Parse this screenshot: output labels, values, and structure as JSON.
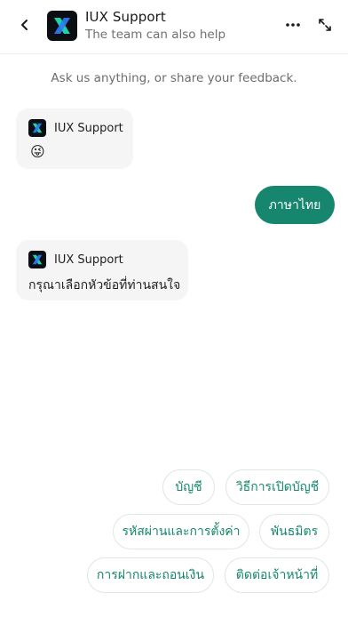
{
  "header": {
    "title": "IUX Support",
    "subtitle": "The team can also help",
    "back_icon": "chevron-left-icon",
    "more_icon": "more-horizontal-icon",
    "expand_icon": "expand-icon",
    "brand_color": "#0b0f14",
    "logo_accent_colors": [
      "#1fd3a8",
      "#2f7cf6"
    ]
  },
  "intro_text": "Ask us anything, or share your feedback.",
  "messages": [
    {
      "sender": "IUX Support",
      "text": "😜",
      "role": "bot"
    },
    {
      "text": "ภาษาไทย",
      "role": "user"
    },
    {
      "sender": "IUX Support",
      "text": "กรุณาเลือกหัวข้อที่ท่านสนใจ",
      "role": "bot"
    }
  ],
  "quick_replies": [
    "บัญชี",
    "วิธีการเปิดบัญชี",
    "รหัสผ่านและการตั้งค่า",
    "พันธมิตร",
    "การฝากและถอนเงิน",
    "ติดต่อเจ้าหน้าที่"
  ],
  "colors": {
    "accent": "#17866e",
    "bubble_bg": "#f5f5f5"
  }
}
